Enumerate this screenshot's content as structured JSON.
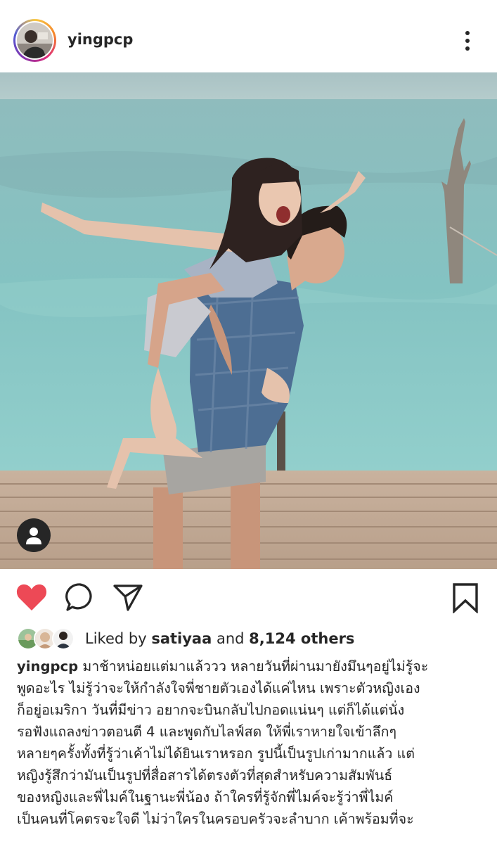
{
  "post": {
    "username": "yingpcp",
    "menu_icon": "more-vertical-icon"
  },
  "actions": {
    "like_icon": "heart-filled-icon",
    "comment_icon": "comment-icon",
    "share_icon": "send-icon",
    "save_icon": "bookmark-icon",
    "like_color": "#ed4956"
  },
  "likes": {
    "prefix": "Liked by",
    "user": "satiyaa",
    "connector": "and",
    "others": "8,124 others"
  },
  "caption": {
    "username": "yingpcp",
    "lines": [
      " มาช้าหน่อยแต่มาแล้ววว หลายวันที่ผ่านมายังมึนๆอยู่ไม่รู้จะ",
      "พูดอะไร ไม่รู้ว่าจะให้กำลังใจพี่ชายตัวเองได้แค่ไหน เพราะตัวหญิงเอง",
      "ก็อยู่อเมริกา วันที่มีข่าว อยากจะบินกลับไปกอดแน่นๆ แต่ก็ได้แต่นั่ง",
      "รอฟังแถลงข่าวตอนตี 4 และพูดกับไลฟ์สด ให้พี่เราหายใจเข้าลึกๆ",
      "หลายๆครั้งทั้งที่รู้ว่าเค้าไม่ได้ยินเราหรอก รูปนี้เป็นรูปเก่ามากแล้ว แต่",
      "หญิงรู้สึกว่ามันเป็นรูปที่สื่อสารได้ตรงตัวที่สุดสำหรับความสัมพันธ์",
      "ของหญิงและพี่ไมค์ในฐานะพี่น้อง ถ้าใครที่รู้จักพี่ไมค์จะรู้ว่าพี่ไมค์",
      "เป็นคนที่โคตรจะใจดี ไม่ว่าใครในครอบครัวจะลำบาก เค้าพร้อมที่จะ"
    ]
  }
}
